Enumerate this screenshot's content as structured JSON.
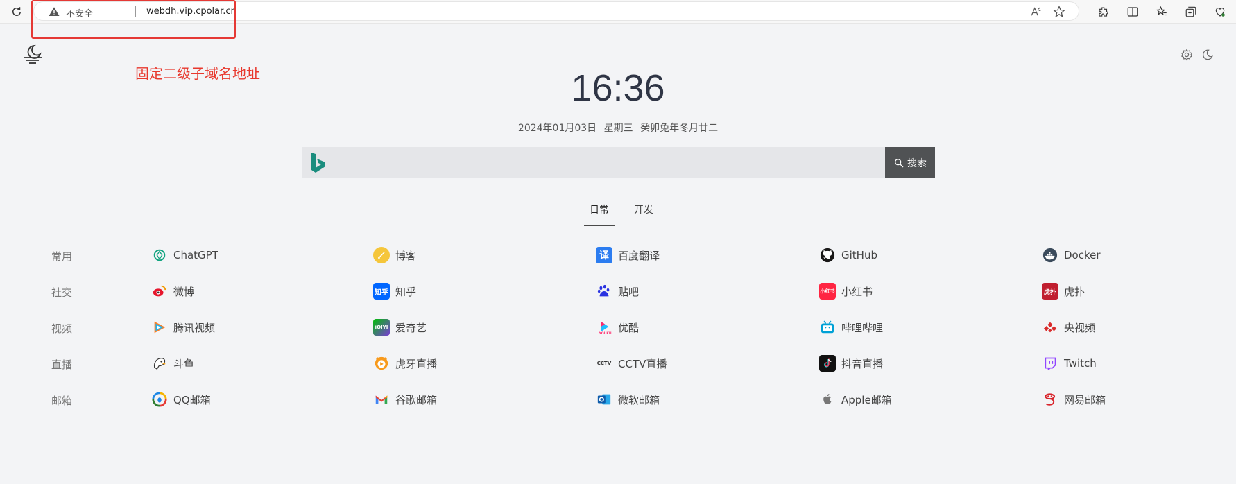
{
  "browser": {
    "insecure_label": "不安全",
    "url": "webdh.vip.cpolar.cn"
  },
  "annotation": "固定二级子域名地址",
  "clock": {
    "time": "16:36",
    "date": "2024年01月03日 星期三 癸卯兔年冬月廿二"
  },
  "search": {
    "placeholder": "",
    "button_label": "搜索"
  },
  "tabs": [
    {
      "label": "日常"
    },
    {
      "label": "开发"
    }
  ],
  "categories": [
    {
      "label": "常用",
      "sites": [
        "ChatGPT",
        "博客",
        "百度翻译",
        "GitHub",
        "Docker"
      ]
    },
    {
      "label": "社交",
      "sites": [
        "微博",
        "知乎",
        "贴吧",
        "小红书",
        "虎扑"
      ]
    },
    {
      "label": "视频",
      "sites": [
        "腾讯视频",
        "爱奇艺",
        "优酷",
        "哔哩哔哩",
        "央视频"
      ]
    },
    {
      "label": "直播",
      "sites": [
        "斗鱼",
        "虎牙直播",
        "CCTV直播",
        "抖音直播",
        "Twitch"
      ]
    },
    {
      "label": "邮箱",
      "sites": [
        "QQ邮箱",
        "谷歌邮箱",
        "微软邮箱",
        "Apple邮箱",
        "网易邮箱"
      ]
    }
  ],
  "icon_text": {
    "zhihu": "知乎",
    "iqiyi": "iQIYI",
    "cctv": "CCTV",
    "xiaohongshu": "小红书",
    "hupu": "虎扑",
    "translate": "译"
  }
}
